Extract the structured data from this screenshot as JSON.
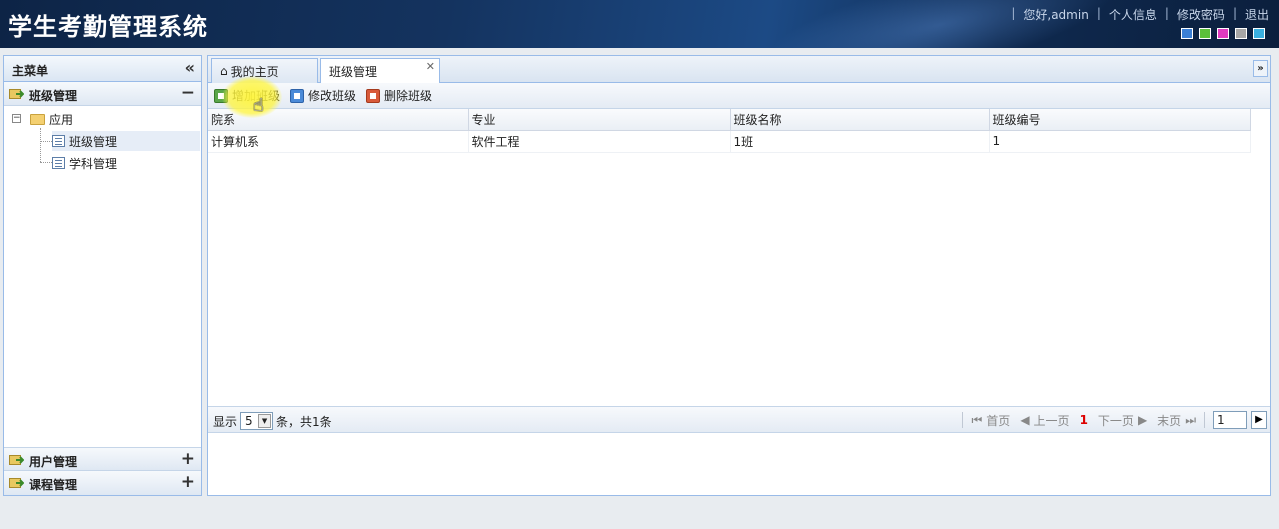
{
  "app": {
    "title": "学生考勤管理系统"
  },
  "top_links": {
    "greeting": "您好,admin",
    "profile": "个人信息",
    "password": "修改密码",
    "logout": "退出"
  },
  "skin_colors": [
    "#3a7fd5",
    "#5bbf3a",
    "#e03bbf",
    "#a6a6a6",
    "#3ab0e0"
  ],
  "sidebar": {
    "title": "主菜单",
    "sections": [
      {
        "label": "班级管理",
        "expanded": true
      },
      {
        "label": "用户管理",
        "expanded": false
      },
      {
        "label": "课程管理",
        "expanded": false
      }
    ],
    "tree": {
      "root": "应用",
      "items": [
        {
          "label": "班级管理",
          "selected": true
        },
        {
          "label": "学科管理",
          "selected": false
        }
      ]
    }
  },
  "tabs": [
    {
      "label": "我的主页",
      "active": false
    },
    {
      "label": "班级管理",
      "active": true
    }
  ],
  "toolbar": {
    "add": "增加班级",
    "edit": "修改班级",
    "delete": "删除班级"
  },
  "grid": {
    "columns": [
      "院系",
      "专业",
      "班级名称",
      "班级编号"
    ],
    "rows": [
      [
        "计算机系",
        "软件工程",
        "1班",
        "1"
      ]
    ]
  },
  "pager": {
    "show_label": "显示",
    "page_size": "5",
    "count_text": "条，共1条",
    "first": "首页",
    "prev": "上一页",
    "current": "1",
    "next": "下一页",
    "last": "末页",
    "page_input": "1"
  }
}
